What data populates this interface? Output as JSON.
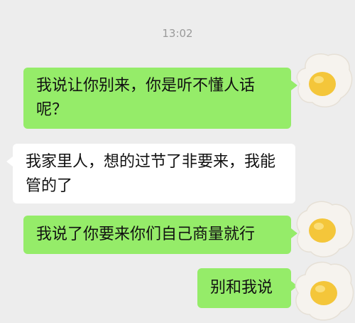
{
  "chat": {
    "timestamp": "13:02",
    "messages": [
      {
        "side": "out",
        "text": "我说让你别来，你是听不懂人话呢？"
      },
      {
        "side": "in",
        "text": "我家里人，想的过节了非要来，我能管的了"
      },
      {
        "side": "out",
        "text": "我说了你要来你们自己商量就行"
      },
      {
        "side": "out",
        "text": "别和我说"
      }
    ]
  },
  "colors": {
    "background": "#ededed",
    "outgoing_bubble": "#95ec69",
    "incoming_bubble": "#ffffff",
    "timestamp_text": "#9a9a9a"
  },
  "icons": {
    "self_avatar": "fried-egg-avatar-icon"
  }
}
